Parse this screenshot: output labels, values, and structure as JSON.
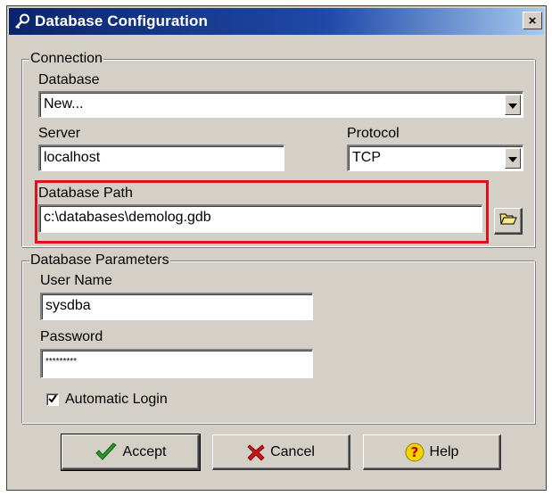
{
  "window": {
    "title": "Database Configuration",
    "close_label": "×",
    "title_icon": "key-icon"
  },
  "connection": {
    "group_label": "Connection",
    "database_label": "Database",
    "database_value": "New...",
    "server_label": "Server",
    "server_value": "localhost",
    "protocol_label": "Protocol",
    "protocol_value": "TCP",
    "path_label": "Database Path",
    "path_value": "c:\\databases\\demolog.gdb",
    "browse_icon": "folder-open-icon"
  },
  "parameters": {
    "group_label": "Database Parameters",
    "username_label": "User Name",
    "username_value": "sysdba",
    "password_label": "Password",
    "password_value": "*********",
    "auto_login_label": "Automatic Login",
    "auto_login_checked": true
  },
  "buttons": {
    "accept_label": "Accept",
    "cancel_label": "Cancel",
    "help_label": "Help"
  },
  "colors": {
    "highlight": "#e0101a",
    "titlebar_start": "#0a246a",
    "titlebar_end": "#a6caf0",
    "dialog_bg": "#d4d0c8"
  }
}
